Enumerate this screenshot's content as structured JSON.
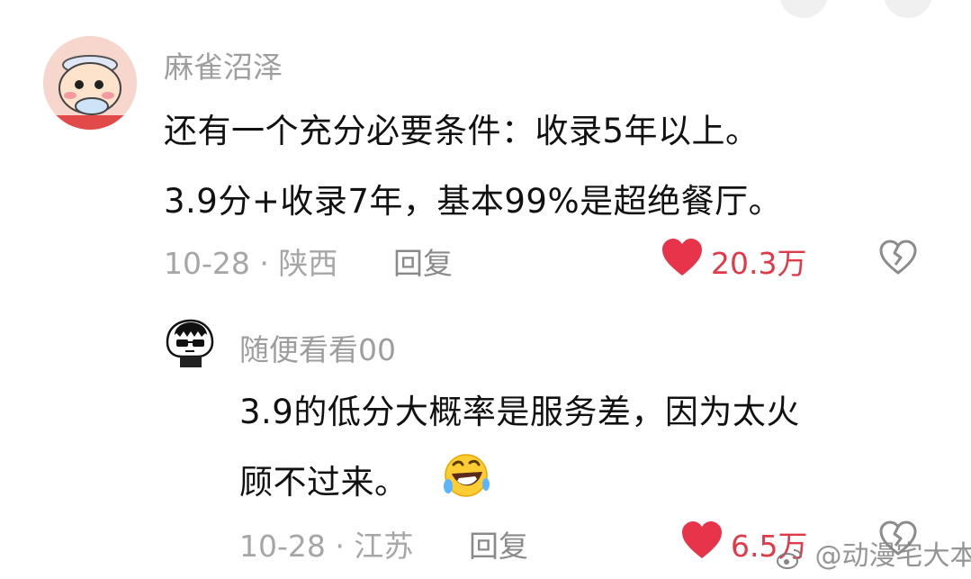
{
  "comment": {
    "username": "麻雀沼泽",
    "text_lines": [
      "还有一个充分必要条件：收录5年以上。",
      "3.9分+收录7年，基本99%是超绝餐厅。"
    ],
    "date": "10-28",
    "location": "陕西",
    "reply_label": "回复",
    "like_count": "20.3万"
  },
  "reply": {
    "username": "随便看看00",
    "text_lines": [
      "3.9的低分大概率是服务差，因为太火",
      "顾不过来。"
    ],
    "emoji": "rolling-on-floor-laughing",
    "date": "10-28",
    "location": "江苏",
    "reply_label": "回复",
    "like_count": "6.5万"
  },
  "watermark": {
    "text": "@动漫宅大本营"
  },
  "separator": "·",
  "colors": {
    "like_red": "#e8344b",
    "muted_text": "#a6a6a6",
    "body_text": "#111111"
  }
}
